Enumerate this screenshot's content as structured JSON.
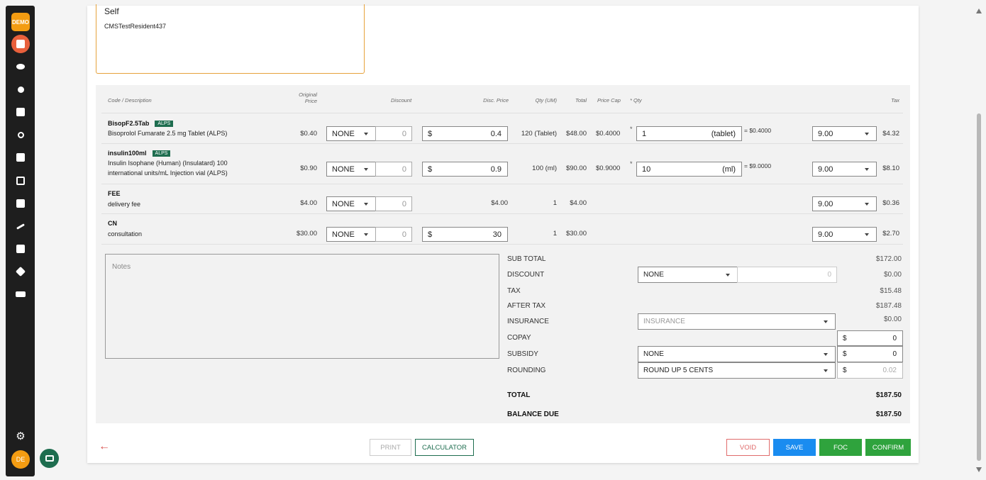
{
  "sidebar": {
    "demo_label": "DEMO",
    "user_initials": "DE",
    "icons": [
      "map-icon",
      "group-icon",
      "person-icon",
      "plus-box-icon",
      "search-icon",
      "dashboard-icon",
      "calendar-icon",
      "store-icon",
      "chart-icon",
      "list-icon",
      "network-icon",
      "truck-icon"
    ],
    "settings_icon": "gear-icon"
  },
  "patient": {
    "name": "Self",
    "resident": "CMSTestResident437"
  },
  "table_headers": {
    "code": "Code / Description",
    "orig_price_1": "Original",
    "orig_price_2": "Price",
    "discount": "Discount",
    "disc_price": "Disc. Price",
    "qty_uom": "Qty (UM)",
    "total": "Total",
    "price_cap": "Price Cap",
    "qty": "* Qty",
    "tax": "Tax"
  },
  "items": [
    {
      "code": "BisopF2.5Tab",
      "badge": "ALPS",
      "desc": "Bisoprolol Fumarate 2.5 mg Tablet (ALPS)",
      "orig_price": "$0.40",
      "disc_type": "NONE",
      "disc_value": "0",
      "currency": "$",
      "disc_price": "0.4",
      "qty_uom": "120 (Tablet)",
      "total": "$48.00",
      "price_cap": "$0.4000",
      "cap_qty": "1",
      "cap_unit": "(tablet)",
      "cap_result": "= $0.4000",
      "tax_rate": "9.00",
      "tax": "$4.32"
    },
    {
      "code": "insulin100ml",
      "badge": "ALPS",
      "desc": "Insulin Isophane (Human) (Insulatard) 100 international units/mL Injection vial (ALPS)",
      "orig_price": "$0.90",
      "disc_type": "NONE",
      "disc_value": "0",
      "currency": "$",
      "disc_price": "0.9",
      "qty_uom": "100 (ml)",
      "total": "$90.00",
      "price_cap": "$0.9000",
      "cap_qty": "10",
      "cap_unit": "(ml)",
      "cap_result": "= $9.0000",
      "tax_rate": "9.00",
      "tax": "$8.10"
    },
    {
      "code": "FEE",
      "desc": "delivery fee",
      "orig_price": "$4.00",
      "disc_type": "NONE",
      "disc_value": "0",
      "disc_price_text": "$4.00",
      "qty_uom": "1",
      "total": "$4.00",
      "tax_rate": "9.00",
      "tax": "$0.36"
    },
    {
      "code": "CN",
      "desc": "consultation",
      "orig_price": "$30.00",
      "disc_type": "NONE",
      "disc_value": "0",
      "currency": "$",
      "disc_price": "30",
      "qty_uom": "1",
      "total": "$30.00",
      "tax_rate": "9.00",
      "tax": "$2.70"
    }
  ],
  "notes_placeholder": "Notes",
  "summary": {
    "subtotal_label": "SUB TOTAL",
    "subtotal": "$172.00",
    "discount_label": "DISCOUNT",
    "discount_type": "NONE",
    "discount_input": "0",
    "discount": "$0.00",
    "tax_label": "TAX",
    "tax": "$15.48",
    "after_tax_label": "AFTER TAX",
    "after_tax": "$187.48",
    "insurance_label": "INSURANCE",
    "insurance_select": "INSURANCE",
    "insurance": "$0.00",
    "copay_label": "COPAY",
    "copay_currency": "$",
    "copay": "0",
    "subsidy_label": "SUBSIDY",
    "subsidy_select": "NONE",
    "subsidy_currency": "$",
    "subsidy": "0",
    "rounding_label": "ROUNDING",
    "rounding_select": "ROUND UP 5 CENTS",
    "rounding_currency": "$",
    "rounding": "0.02",
    "total_label": "TOTAL",
    "total": "$187.50",
    "balance_label": "BALANCE DUE",
    "balance": "$187.50"
  },
  "footer": {
    "back_icon": "arrow-left-icon",
    "print": "PRINT",
    "calculator": "CALCULATOR",
    "void": "VOID",
    "save": "SAVE",
    "foc": "FOC",
    "confirm": "CONFIRM"
  },
  "colors": {
    "accent_green": "#1e6d4f",
    "save_blue": "#1a8cf0",
    "confirm_green": "#2fa33d",
    "void_red": "#e06b6b",
    "sidebar_bg": "#1e1e1e",
    "orange": "#f39c12"
  }
}
